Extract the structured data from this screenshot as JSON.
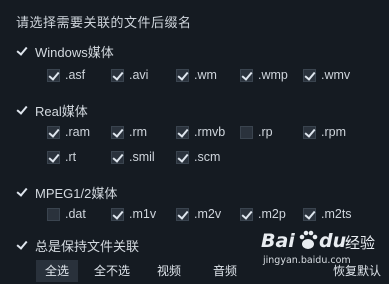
{
  "title": "请选择需要关联的文件后缀名",
  "groups": [
    {
      "label": "Windows媒体",
      "checked": true,
      "items": [
        {
          "ext": ".asf",
          "checked": true
        },
        {
          "ext": ".avi",
          "checked": true
        },
        {
          "ext": ".wm",
          "checked": true
        },
        {
          "ext": ".wmp",
          "checked": true
        },
        {
          "ext": ".wmv",
          "checked": true
        }
      ]
    },
    {
      "label": "Real媒体",
      "checked": true,
      "items": [
        {
          "ext": ".ram",
          "checked": true
        },
        {
          "ext": ".rm",
          "checked": true
        },
        {
          "ext": ".rmvb",
          "checked": true
        },
        {
          "ext": ".rp",
          "checked": false
        },
        {
          "ext": ".rpm",
          "checked": true
        },
        {
          "ext": ".rt",
          "checked": true
        },
        {
          "ext": ".smil",
          "checked": true
        },
        {
          "ext": ".scm",
          "checked": true
        }
      ]
    },
    {
      "label": "MPEG1/2媒体",
      "checked": true,
      "items": [
        {
          "ext": ".dat",
          "checked": false
        },
        {
          "ext": ".m1v",
          "checked": true
        },
        {
          "ext": ".m2v",
          "checked": true
        },
        {
          "ext": ".m2p",
          "checked": true
        },
        {
          "ext": ".m2ts",
          "checked": true
        }
      ]
    }
  ],
  "always_keep": {
    "label": "总是保持文件关联",
    "checked": true
  },
  "buttons": {
    "select_all": "全选",
    "select_none": "全不选",
    "video": "视频",
    "audio": "音频",
    "restore_default": "恢复默认"
  },
  "watermark": {
    "brand_a": "Bai",
    "brand_b": "du",
    "brand_suffix": "经验",
    "url": "jingyan.baidu.com"
  },
  "colors": {
    "background": "#151b22",
    "checkbox": "#2a323c",
    "active_button": "#29313b",
    "text": "#cfd5dc"
  }
}
